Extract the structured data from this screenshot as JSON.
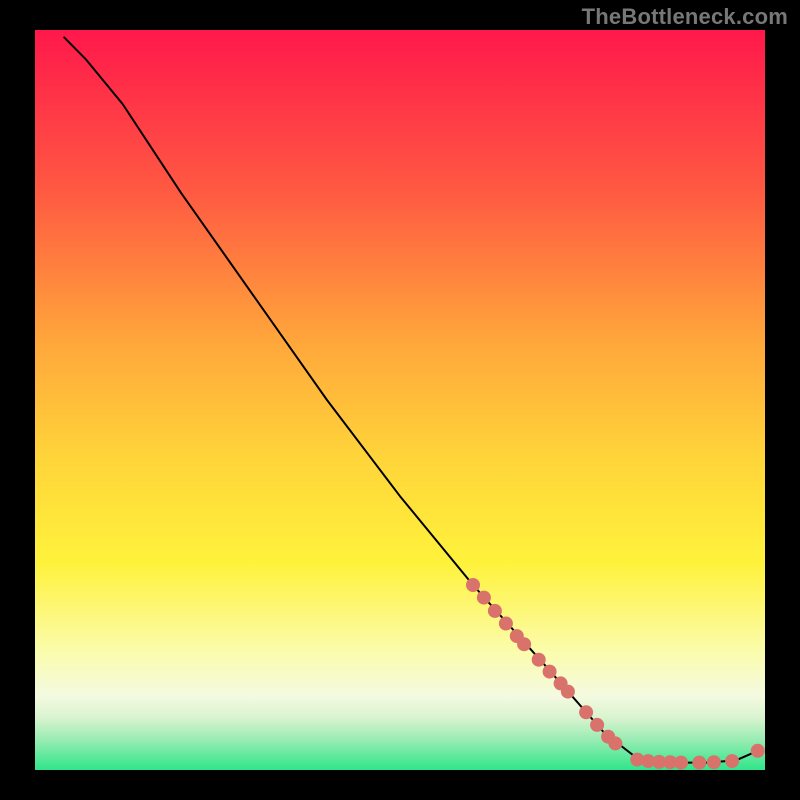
{
  "watermark": "TheBottleneck.com",
  "chart_data": {
    "type": "line",
    "title": "",
    "xlabel": "",
    "ylabel": "",
    "xlim": [
      0,
      100
    ],
    "ylim": [
      0,
      100
    ],
    "grid": false,
    "legend": false,
    "gradient_colors": {
      "top": "#ff184b",
      "mid_upper": "#ff7d3d",
      "mid": "#ffdт03a",
      "mid_lower": "#fff23b",
      "lower_light": "#fcfdb7",
      "pale_green": "#d7f6cb",
      "green": "#2fe58a"
    },
    "curve": [
      {
        "x": 4,
        "y": 99
      },
      {
        "x": 7,
        "y": 96
      },
      {
        "x": 12,
        "y": 90
      },
      {
        "x": 20,
        "y": 78
      },
      {
        "x": 30,
        "y": 64
      },
      {
        "x": 40,
        "y": 50
      },
      {
        "x": 50,
        "y": 37
      },
      {
        "x": 60,
        "y": 25
      },
      {
        "x": 70,
        "y": 14
      },
      {
        "x": 78,
        "y": 5
      },
      {
        "x": 83,
        "y": 1.2
      },
      {
        "x": 88,
        "y": 1.0
      },
      {
        "x": 92,
        "y": 1.0
      },
      {
        "x": 96,
        "y": 1.3
      },
      {
        "x": 99,
        "y": 2.6
      }
    ],
    "markers": [
      {
        "x": 60.0,
        "y": 25.0
      },
      {
        "x": 61.5,
        "y": 23.3
      },
      {
        "x": 63.0,
        "y": 21.5
      },
      {
        "x": 64.5,
        "y": 19.8
      },
      {
        "x": 66.0,
        "y": 18.1
      },
      {
        "x": 67.0,
        "y": 17.0
      },
      {
        "x": 69.0,
        "y": 14.9
      },
      {
        "x": 70.5,
        "y": 13.3
      },
      {
        "x": 72.0,
        "y": 11.7
      },
      {
        "x": 73.0,
        "y": 10.6
      },
      {
        "x": 75.5,
        "y": 7.8
      },
      {
        "x": 77.0,
        "y": 6.1
      },
      {
        "x": 78.5,
        "y": 4.5
      },
      {
        "x": 79.5,
        "y": 3.6
      },
      {
        "x": 82.5,
        "y": 1.4
      },
      {
        "x": 84.0,
        "y": 1.2
      },
      {
        "x": 85.5,
        "y": 1.1
      },
      {
        "x": 87.0,
        "y": 1.05
      },
      {
        "x": 88.5,
        "y": 1.0
      },
      {
        "x": 91.0,
        "y": 1.0
      },
      {
        "x": 93.0,
        "y": 1.05
      },
      {
        "x": 95.5,
        "y": 1.2
      },
      {
        "x": 99.0,
        "y": 2.6
      }
    ],
    "marker_color": "#d8726b",
    "marker_radius": 7,
    "line_color": "#000000",
    "line_width": 2
  }
}
